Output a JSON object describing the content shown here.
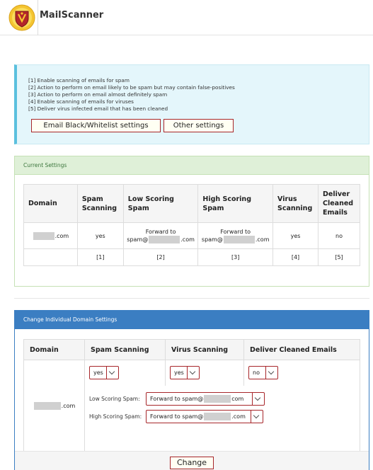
{
  "app": {
    "title": "MailScanner"
  },
  "info": {
    "lines": [
      "[1] Enable scanning of emails for spam",
      "[2] Action to perform on email likely to be spam but may contain false-positives",
      "[3] Action to perform on email almost definitely spam",
      "[4] Enable scanning of emails for viruses",
      "[5] Deliver virus infected email that has been cleaned"
    ],
    "buttons": {
      "blacklist": "Email Black/Whitelist settings",
      "other": "Other settings"
    }
  },
  "current": {
    "heading": "Current Settings",
    "headers": [
      "Domain",
      "Spam Scanning",
      "Low Scoring Spam",
      "High Scoring Spam",
      "Virus Scanning",
      "Deliver Cleaned Emails"
    ],
    "row": {
      "domain_suffix": ".com",
      "spam": "yes",
      "low_line1": "Forward to",
      "low_prefix": "spam@",
      "low_suffix": ".com",
      "high_line1": "Forward to",
      "high_prefix": "spam@",
      "high_suffix": ".com",
      "virus": "yes",
      "deliver": "no"
    },
    "indices": [
      "[1]",
      "[2]",
      "[3]",
      "[4]",
      "[5]"
    ]
  },
  "change": {
    "heading": "Change Individual Domain Settings",
    "headers": [
      "Domain",
      "Spam Scanning",
      "Virus Scanning",
      "Deliver Cleaned Emails"
    ],
    "domain_suffix": ".com",
    "spam_value": "yes",
    "virus_value": "yes",
    "deliver_value": "no",
    "low_label": "Low Scoring Spam:",
    "high_label": "High Scoring Spam:",
    "low_value_prefix": "Forward to spam@",
    "low_value_suffix": "com",
    "high_value_prefix": "Forward to spam@",
    "high_value_suffix": ".com",
    "submit": "Change"
  },
  "colors": {
    "accent_blue": "#3b7ec2",
    "success_bg": "#dff0d8",
    "info_bg": "#e4f6fb",
    "button_border": "#a7262a"
  }
}
